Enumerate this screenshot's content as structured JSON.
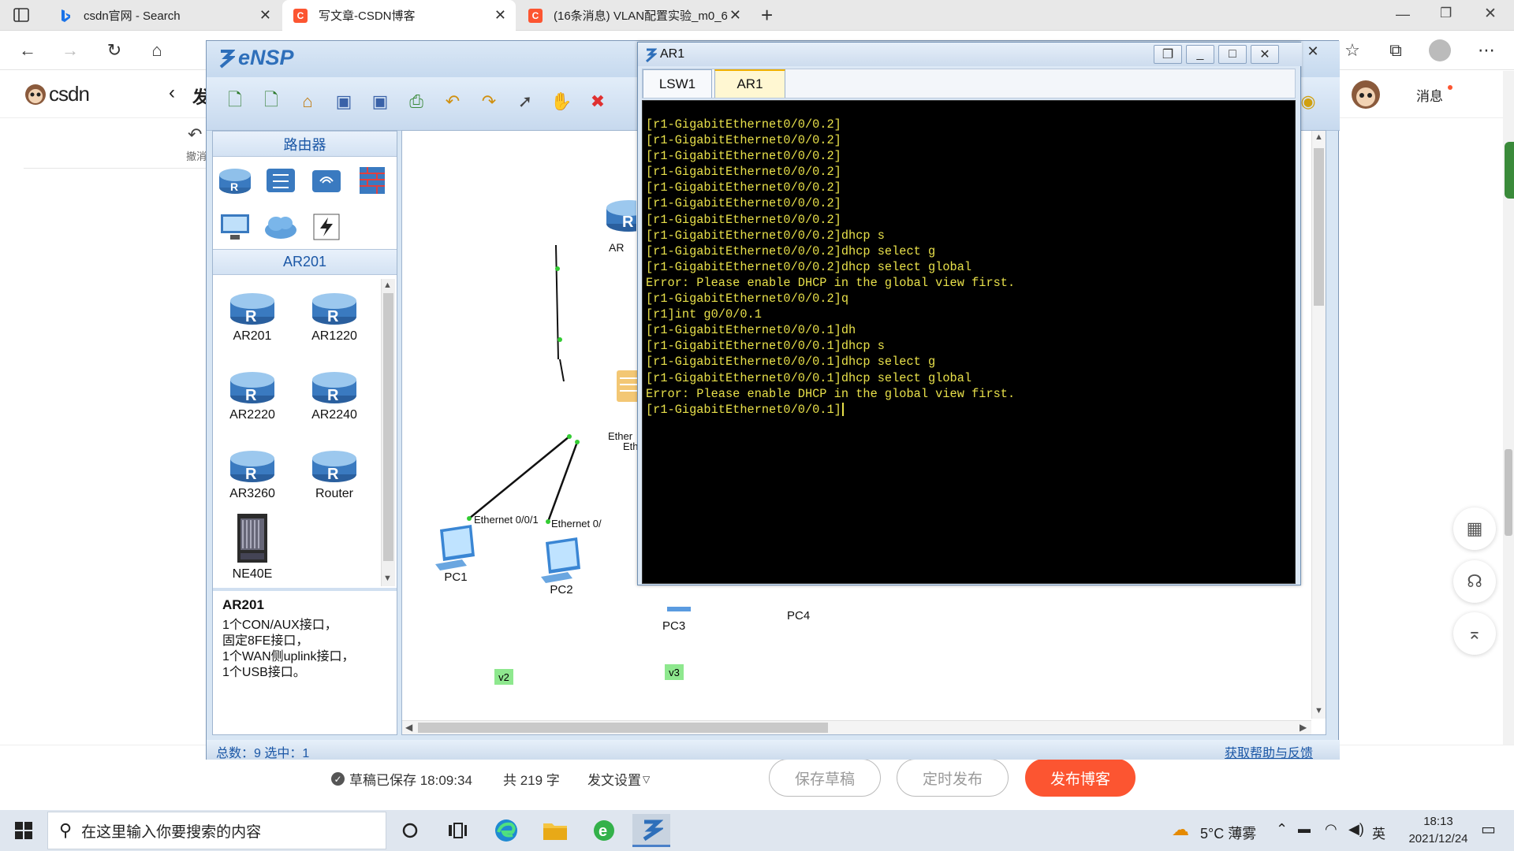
{
  "browser": {
    "tabs": [
      {
        "title": "csdn官网 - Search",
        "icon": "bing-icon"
      },
      {
        "title": "写文章-CSDN博客",
        "icon": "csdn-icon"
      },
      {
        "title": "(16条消息) VLAN配置实验_m0_6",
        "icon": "csdn-icon"
      }
    ],
    "new_tab": "+",
    "address": ""
  },
  "csdn": {
    "logo": "csdn",
    "back_label": "发",
    "undo_label": "撤消",
    "message_label": "消息",
    "footer": {
      "saved_status": "草稿已保存 18:09:34",
      "word_count": "共 219 字",
      "publish_settings": "发文设置",
      "save_draft": "保存草稿",
      "schedule": "定时发布",
      "publish": "发布博客"
    }
  },
  "ensp": {
    "title": "eNSP",
    "panel_category": "路由器",
    "panel_subcategory": "AR201",
    "devices": [
      "AR201",
      "AR1220",
      "AR2220",
      "AR2240",
      "AR3260",
      "Router",
      "NE40E"
    ],
    "description": {
      "name": "AR201",
      "lines": [
        "1个CON/AUX接口，",
        "固定8FE接口，",
        "1个WAN侧uplink接口，",
        "1个USB接口。"
      ]
    },
    "canvas": {
      "nodes": [
        "AR",
        "PC1",
        "PC2",
        "PC3",
        "PC4"
      ],
      "link_labels": [
        "Ethernet 0/0/1",
        "Ethernet 0/",
        "Ether",
        "Eth"
      ],
      "vlan_labels": [
        "v2",
        "v3"
      ]
    },
    "status": {
      "summary": "总数：9  选中：1",
      "help_link": "获取帮助与反馈"
    }
  },
  "terminal": {
    "title": "AR1",
    "tabs": [
      "LSW1",
      "AR1"
    ],
    "active_tab": "AR1",
    "lines": [
      "[r1-GigabitEthernet0/0/0.2]",
      "[r1-GigabitEthernet0/0/0.2]",
      "[r1-GigabitEthernet0/0/0.2]",
      "[r1-GigabitEthernet0/0/0.2]",
      "[r1-GigabitEthernet0/0/0.2]",
      "[r1-GigabitEthernet0/0/0.2]",
      "[r1-GigabitEthernet0/0/0.2]",
      "[r1-GigabitEthernet0/0/0.2]dhcp s",
      "[r1-GigabitEthernet0/0/0.2]dhcp select g",
      "[r1-GigabitEthernet0/0/0.2]dhcp select global",
      "Error: Please enable DHCP in the global view first.",
      "[r1-GigabitEthernet0/0/0.2]q",
      "[r1]int g0/0/0.1",
      "[r1-GigabitEthernet0/0/0.1]dh",
      "[r1-GigabitEthernet0/0/0.1]dhcp s",
      "[r1-GigabitEthernet0/0/0.1]dhcp select g",
      "[r1-GigabitEthernet0/0/0.1]dhcp select global",
      "Error: Please enable DHCP in the global view first.",
      "[r1-GigabitEthernet0/0/0.1]"
    ]
  },
  "taskbar": {
    "search_placeholder": "在这里输入你要搜索的内容",
    "weather": "5°C  薄雾",
    "ime": "英",
    "time": "18:13",
    "date": "2021/12/24"
  }
}
